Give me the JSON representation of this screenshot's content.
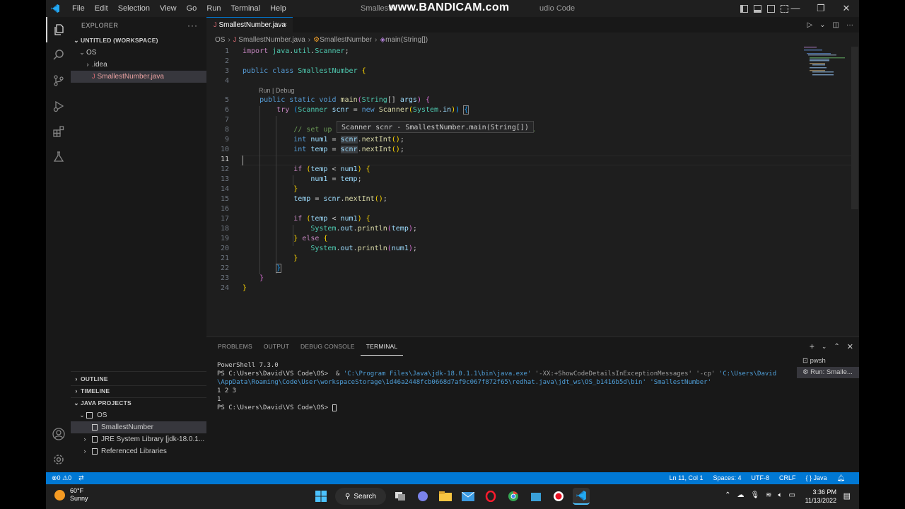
{
  "titlebar": {
    "menu": [
      "File",
      "Edit",
      "Selection",
      "View",
      "Go",
      "Run",
      "Terminal",
      "Help"
    ],
    "title_left": "SmallestN",
    "title_right": "udio Code",
    "watermark": "www.BANDICAM.com"
  },
  "sidebar": {
    "header": "EXPLORER",
    "workspace": "UNTITLED (WORKSPACE)",
    "folder_os": "OS",
    "idea": ".idea",
    "file": "SmallestNumber.java",
    "outline": "OUTLINE",
    "timeline": "TIMELINE",
    "java_projects": "JAVA PROJECTS",
    "project_os": "OS",
    "project_class": "SmallestNumber",
    "jre": "JRE System Library [jdk-18.0.1...",
    "ref_libs": "Referenced Libraries"
  },
  "tabs": {
    "active_label": "SmallestNumber.java",
    "close": "×"
  },
  "breadcrumb": {
    "folder": "OS",
    "file": "SmallestNumber.java",
    "class": "SmallestNumber",
    "method": "main(String[])"
  },
  "editor": {
    "codelens": "Run | Debug",
    "tooltip": "Scanner scnr - SmallestNumber.main(String[])",
    "line_numbers": [
      "1",
      "2",
      "3",
      "4",
      "5",
      "6",
      "7",
      "8",
      "9",
      "10",
      "11",
      "12",
      "13",
      "14",
      "15",
      "16",
      "17",
      "18",
      "19",
      "20",
      "21",
      "22",
      "23",
      "24"
    ],
    "current_line": "11"
  },
  "panel": {
    "tabs": [
      "PROBLEMS",
      "OUTPUT",
      "DEBUG CONSOLE",
      "TERMINAL"
    ],
    "active_tab": "TERMINAL",
    "terminal": {
      "line1": "PowerShell 7.3.0",
      "prompt": "PS C:\\Users\\David\\VS Code\\OS> ",
      "cmd_amp": " & ",
      "java_exe": "'C:\\Program Files\\Java\\jdk-18.0.1.1\\bin\\java.exe'",
      "flag": " '-XX:+ShowCodeDetailsInExceptionMessages' '-cp' ",
      "classpath": "'C:\\Users\\David\\AppData\\Roaming\\Code\\User\\workspaceStorage\\1d46a2448fcb0668d7af9c067f872f65\\redhat.java\\jdt_ws\\OS_b1416b5d\\bin'",
      "main_class": " 'SmallestNumber'",
      "input": "1 2 3",
      "output": "1",
      "prompt2": "PS C:\\Users\\David\\VS Code\\OS> "
    },
    "terminal_list": [
      "pwsh",
      "Run: Smalle..."
    ]
  },
  "statusbar": {
    "errors": "0",
    "warnings": "0",
    "position": "Ln 11, Col 1",
    "spaces": "Spaces: 4",
    "encoding": "UTF-8",
    "eol": "CRLF",
    "language": "{ } Java"
  },
  "taskbar": {
    "temp": "60°F",
    "condition": "Sunny",
    "search": "Search",
    "time": "3:36 PM",
    "date": "11/13/2022"
  },
  "colors": {
    "accent": "#0078d4",
    "editor_bg": "#1e1e1e",
    "sidebar_bg": "#181818"
  }
}
